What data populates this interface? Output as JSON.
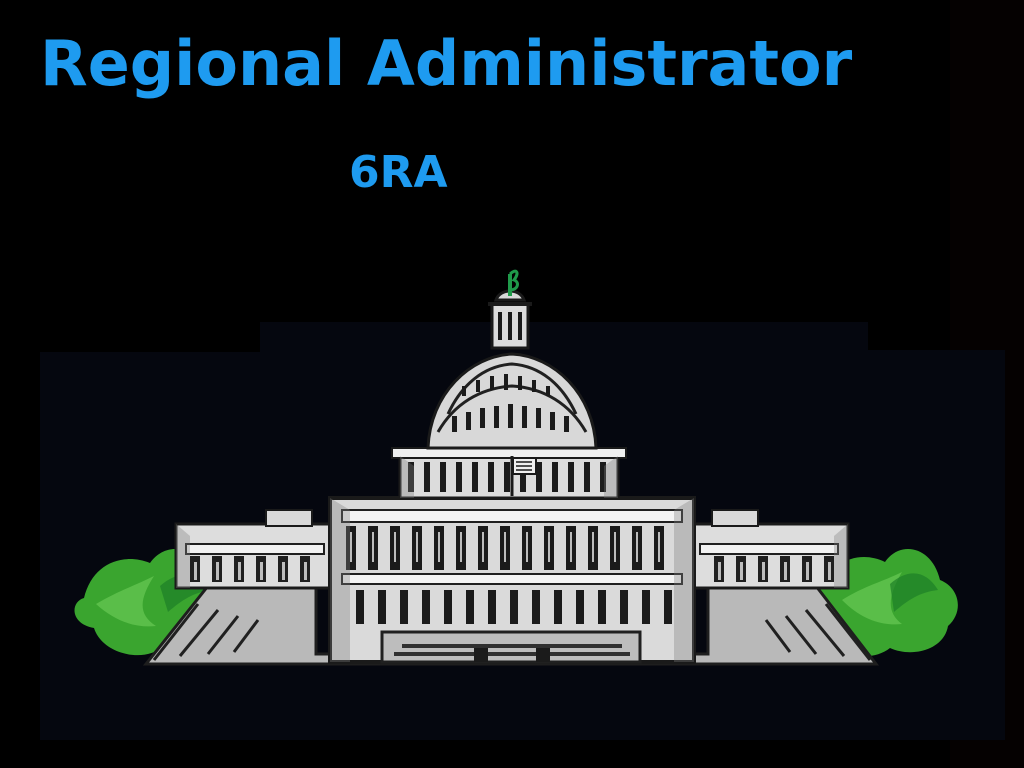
{
  "slide": {
    "title": "Regional Administrator",
    "subtitle": "6RA"
  },
  "artwork": {
    "subject": "capitol-building-icon",
    "colors": {
      "background": "#000000",
      "heading": "#1e9bf0",
      "building": "#d9d9d9",
      "building_shadow": "#7f7f7f",
      "trees": "#3aa52f",
      "flag_top": "#1f9a4a"
    }
  }
}
